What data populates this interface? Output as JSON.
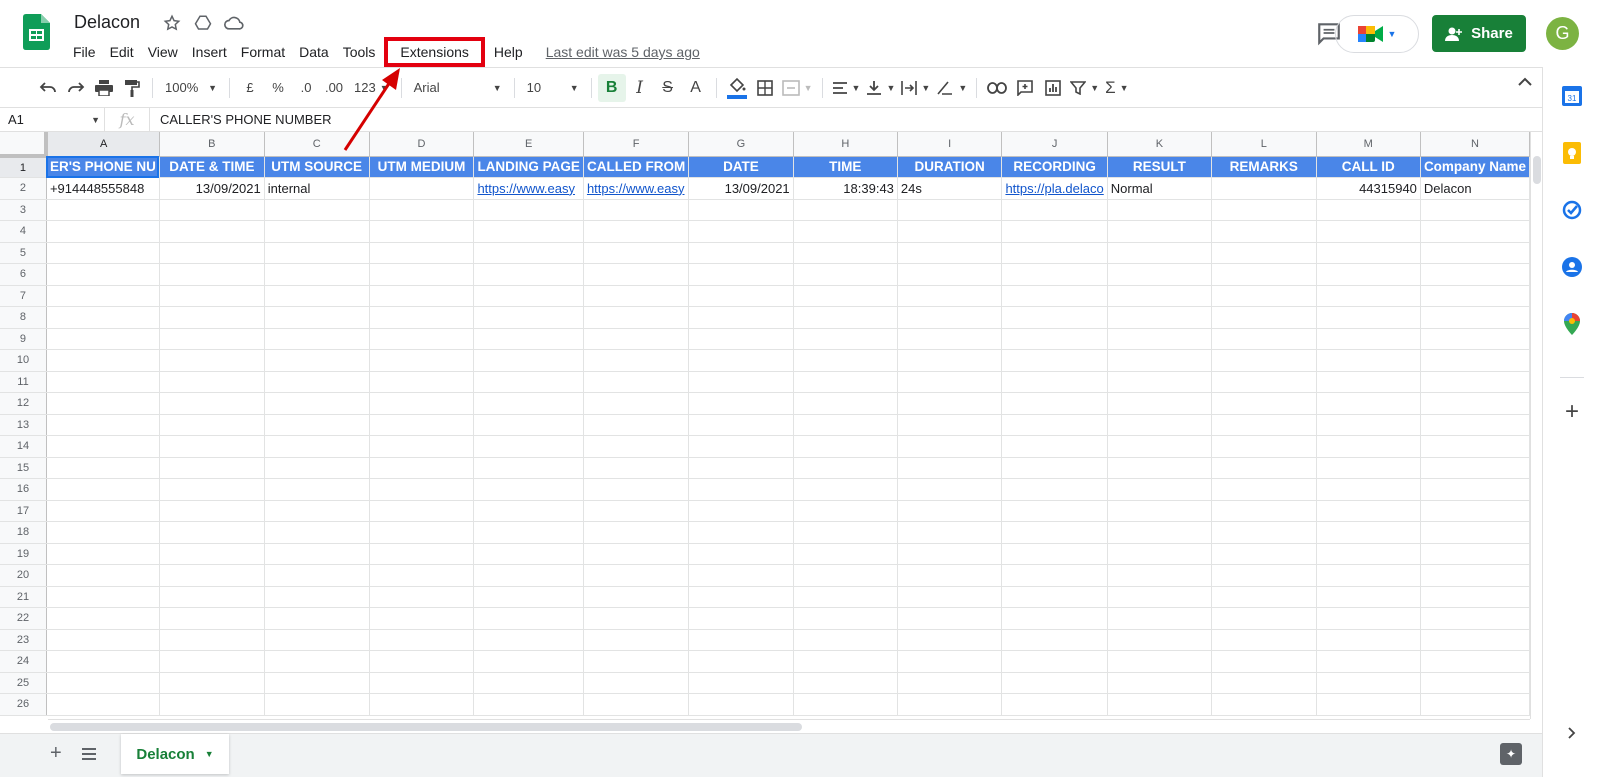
{
  "doc": {
    "title": "Delacon",
    "last_edit": "Last edit was 5 days ago"
  },
  "menu": [
    "File",
    "Edit",
    "View",
    "Insert",
    "Format",
    "Data",
    "Tools",
    "Extensions",
    "Help"
  ],
  "header": {
    "share_label": "Share",
    "avatar_initial": "G"
  },
  "toolbar": {
    "zoom": "100%",
    "currency": "£",
    "percent": "%",
    "dec_decrease": ".0",
    "dec_increase": ".00",
    "format_more": "123",
    "font": "Arial",
    "font_size": "10",
    "bold": "B",
    "italic": "I",
    "strike": "S",
    "text_color": "A"
  },
  "formula": {
    "cell_ref": "A1",
    "fx": "fx",
    "value": "CALLER'S PHONE NUMBER"
  },
  "columns": [
    "A",
    "B",
    "C",
    "D",
    "E",
    "F",
    "G",
    "H",
    "I",
    "J",
    "K",
    "L",
    "M",
    "N"
  ],
  "rows_count": 26,
  "header_row": [
    "ER'S PHONE NU",
    "DATE & TIME",
    "UTM SOURCE",
    "UTM MEDIUM",
    "LANDING PAGE",
    "CALLED FROM",
    "DATE",
    "TIME",
    "DURATION",
    "RECORDING",
    "RESULT",
    "REMARKS",
    "CALL ID",
    "Company Name"
  ],
  "data_rows": [
    [
      "+914448555848",
      "13/09/2021",
      "internal",
      "",
      "https://www.easy",
      "https://www.easy",
      "13/09/2021",
      "18:39:43",
      "24s",
      "https://pla.delaco",
      "Normal",
      "",
      "44315940",
      "Delacon"
    ]
  ],
  "sheet_tab": {
    "name": "Delacon"
  },
  "colors": {
    "header_fill": "#4a86e8",
    "share_green": "#188038",
    "highlight_red": "#e3000f",
    "link_blue": "#1155cc"
  }
}
